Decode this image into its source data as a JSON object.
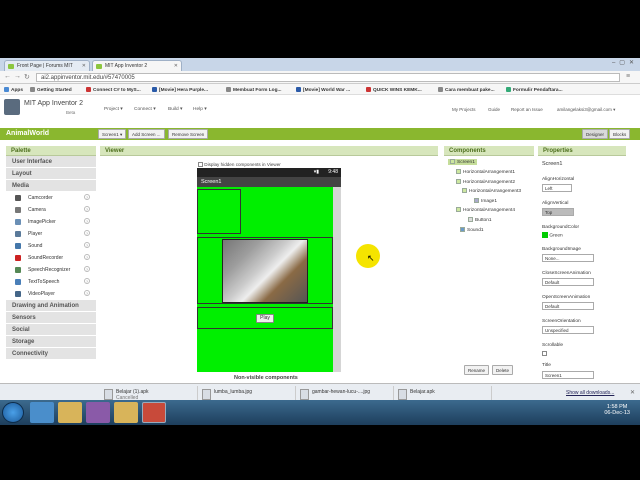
{
  "tabs": [
    {
      "label": "Front Page | Forums MIT"
    },
    {
      "label": "MIT App Inventor 2"
    }
  ],
  "address": "ai2.appinventor.mit.edu/#57470005",
  "bookmarks": [
    "Apps",
    "Getting Started",
    "Connect C# to MyS...",
    "[Movie] Hera Purple...",
    "Membuat Form Log...",
    "[Movie] World War ...",
    "QUICK WINS KEMK...",
    "Cara membuat pake...",
    "Formulir Pendaftara..."
  ],
  "header": {
    "title": "MIT App Inventor 2",
    "beta": "Beta",
    "menus": [
      "Project ▾",
      "Connect ▾",
      "Build ▾",
      "Help ▾"
    ],
    "links": [
      "My Projects",
      "Guide",
      "Report an Issue",
      "amilangelaksi3@gmail.com ▾"
    ]
  },
  "project": {
    "name": "AnimalWorld",
    "screen_btn": "Screen1 ▾",
    "add_screen": "Add Screen ...",
    "remove_screen": "Remove Screen",
    "designer": "Designer",
    "blocks": "Blocks"
  },
  "palette": {
    "title": "Palette",
    "categories_top": [
      "User Interface",
      "Layout",
      "Media"
    ],
    "media_items": [
      {
        "label": "Camcorder",
        "color": "#555555"
      },
      {
        "label": "Camera",
        "color": "#777777"
      },
      {
        "label": "ImagePicker",
        "color": "#6a8fb5"
      },
      {
        "label": "Player",
        "color": "#5a7a9a"
      },
      {
        "label": "Sound",
        "color": "#4477aa"
      },
      {
        "label": "SoundRecorder",
        "color": "#cc2222"
      },
      {
        "label": "SpeechRecognizer",
        "color": "#558855"
      },
      {
        "label": "TextToSpeech",
        "color": "#4a7fb8"
      },
      {
        "label": "VideoPlayer",
        "color": "#446688"
      }
    ],
    "categories_bottom": [
      "Drawing and Animation",
      "Sensors",
      "Social",
      "Storage",
      "Connectivity"
    ]
  },
  "viewer": {
    "title": "Viewer",
    "checkbox_label": "Display hidden components in Viewer",
    "time": "9:48",
    "screen_title": "Screen1",
    "play_label": "Play",
    "nonvisible": "Non-visible components"
  },
  "components": {
    "title": "Components",
    "tree": [
      "Screen1",
      "HorizontalArrangement1",
      "HorizontalArrangement2",
      "HorizontalArrangement3",
      "Image1",
      "HorizontalArrangement4",
      "Button1",
      "Sound1"
    ],
    "rename": "Rename",
    "delete": "Delete"
  },
  "properties": {
    "title": "Properties",
    "screen": "Screen1",
    "align_h_label": "AlignHorizontal",
    "align_h_value": "Left",
    "align_v_label": "AlignVertical",
    "align_v_value": "Top",
    "bg_color_label": "BackgroundColor",
    "bg_color_value": "Green",
    "bg_image_label": "BackgroundImage",
    "bg_image_value": "None...",
    "close_anim_label": "CloseScreenAnimation",
    "close_anim_value": "Default",
    "open_anim_label": "OpenScreenAnimation",
    "open_anim_value": "Default",
    "orientation_label": "ScreenOrientation",
    "orientation_value": "Unspecified",
    "scrollable_label": "Scrollable",
    "title_label": "Title",
    "title_value": "Screen1"
  },
  "downloads": {
    "items": [
      {
        "name": "Belajar (1).apk",
        "status": "Cancelled"
      },
      {
        "name": "lumba_lumba.jpg",
        "status": ""
      },
      {
        "name": "gambar-hewan-lucu-....jpg",
        "status": ""
      },
      {
        "name": "Belajar.apk",
        "status": ""
      }
    ],
    "show_all": "Show all downloads..."
  },
  "taskbar": {
    "time": "1:58 PM",
    "date": "06-Dec-13"
  },
  "colors": {
    "accent": "#8ab72f",
    "screen_bg": "#00ef00"
  }
}
